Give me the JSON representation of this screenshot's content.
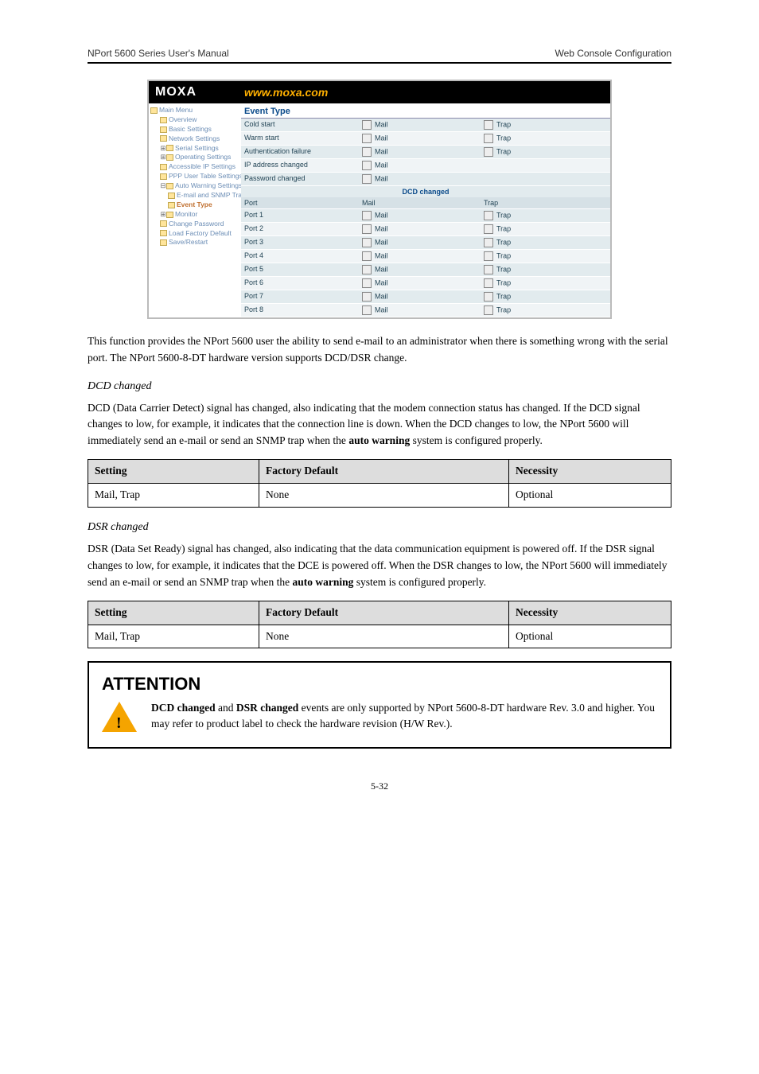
{
  "header": {
    "left": "NPort 5600 Series User's Manual",
    "right": "Web Console Configuration",
    "footer": "5-32"
  },
  "screenshot": {
    "banner": {
      "logo": "MOXA",
      "url": "www.moxa.com"
    },
    "nav_root": "Main Menu",
    "nav": [
      {
        "t": "Overview"
      },
      {
        "t": "Basic Settings"
      },
      {
        "t": "Network Settings"
      },
      {
        "t": "Serial Settings",
        "exp": true
      },
      {
        "t": "Operating Settings",
        "exp": true
      },
      {
        "t": "Accessible IP Settings"
      },
      {
        "t": "PPP User Table Settings"
      },
      {
        "t": "Auto Warning Settings",
        "open": true
      },
      {
        "t": "E-mail and SNMP Trap",
        "deep": true
      },
      {
        "t": "Event Type",
        "deep": true,
        "cur": true
      },
      {
        "t": "Monitor",
        "exp": true
      },
      {
        "t": "Change Password"
      },
      {
        "t": "Load Factory Default"
      },
      {
        "t": "Save/Restart"
      }
    ],
    "main_title": "Event Type",
    "events_rows": [
      {
        "l": "Cold start",
        "m": "Mail",
        "t": "Trap"
      },
      {
        "l": "Warm start",
        "m": "Mail",
        "t": "Trap"
      },
      {
        "l": "Authentication failure",
        "m": "Mail",
        "t": "Trap"
      },
      {
        "l": "IP address changed",
        "m": "Mail",
        "t": ""
      },
      {
        "l": "Password changed",
        "m": "Mail",
        "t": ""
      }
    ],
    "dcd_header": "DCD changed",
    "port_columns": {
      "c1": "Port",
      "c2": "Mail",
      "c3": "Trap"
    },
    "ports": [
      {
        "l": "Port 1",
        "m": "Mail",
        "t": "Trap"
      },
      {
        "l": "Port 2",
        "m": "Mail",
        "t": "Trap"
      },
      {
        "l": "Port 3",
        "m": "Mail",
        "t": "Trap"
      },
      {
        "l": "Port 4",
        "m": "Mail",
        "t": "Trap"
      },
      {
        "l": "Port 5",
        "m": "Mail",
        "t": "Trap"
      },
      {
        "l": "Port 6",
        "m": "Mail",
        "t": "Trap"
      },
      {
        "l": "Port 7",
        "m": "Mail",
        "t": "Trap"
      },
      {
        "l": "Port 8",
        "m": "Mail",
        "t": "Trap"
      }
    ]
  },
  "intro_para": "This function provides the NPort 5600 user the ability to send e-mail to an administrator when there is something wrong with the serial port. The NPort 5600-8-DT hardware version supports DCD/DSR change.",
  "dcd_heading": "DCD changed",
  "dcd_para1_pre": "DCD (Data Carrier Detect) signal has changed, also indicating that the modem connection status has changed. If the DCD signal changes to low, for example, it indicates that the connection line is down. When the DCD changes to low, the NPort 5600 will immediately send an e-mail or send an SNMP trap when the ",
  "dcd_para1_code": "auto warning",
  "dcd_para1_post": " system is configured properly.",
  "table1": {
    "hdr": [
      "Setting",
      "Factory Default",
      "Necessity"
    ],
    "row": [
      "Mail, Trap",
      "None",
      "Optional"
    ]
  },
  "dsr_heading": "DSR changed",
  "dsr_para_pre": "DSR (Data Set Ready) signal has changed, also indicating that the data communication equipment is powered off. If the DSR signal changes to low, for example, it indicates that the DCE is powered off. When the DSR changes to low, the NPort 5600 will immediately send an e-mail or send an SNMP trap when the ",
  "dsr_para_code": "auto warning",
  "dsr_para_post": " system is configured properly.",
  "table2": {
    "hdr": [
      "Setting",
      "Factory Default",
      "Necessity"
    ],
    "row": [
      "Mail, Trap",
      "None",
      "Optional"
    ]
  },
  "attention": {
    "label": "ATTENTION",
    "pre": "",
    "b1": "DCD changed",
    "mid": " and ",
    "b2": "DSR changed",
    "post": " events are only supported by NPort 5600-8-DT hardware Rev. 3.0 and higher. You may refer to product label to check the hardware revision (H/W Rev.)."
  }
}
